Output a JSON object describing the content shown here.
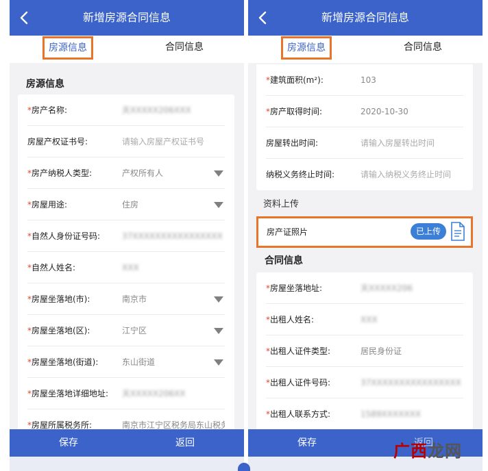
{
  "left": {
    "title": "新增房源合同信息",
    "tabs": {
      "source": "房源信息",
      "contract": "合同信息"
    },
    "section_title": "房源信息",
    "rows": [
      {
        "label": "房产名称:",
        "required": true,
        "value": "天XXXXX206XXX",
        "kind": "blur"
      },
      {
        "label": "房屋产权证书号:",
        "required": false,
        "value": "请输入房屋产权证书号",
        "kind": "ph"
      },
      {
        "label": "房产纳税人类型:",
        "required": true,
        "value": "产权所有人",
        "kind": "select"
      },
      {
        "label": "房屋用途:",
        "required": true,
        "value": "住房",
        "kind": "select"
      },
      {
        "label": "自然人身份证号码:",
        "required": true,
        "value": "37XXXXXXXXXXXXXXXX",
        "kind": "blur"
      },
      {
        "label": "自然人姓名:",
        "required": true,
        "value": "XXX",
        "kind": "blur"
      },
      {
        "label": "房屋坐落地(市):",
        "required": true,
        "value": "南京市",
        "kind": "select"
      },
      {
        "label": "房屋坐落地(区):",
        "required": true,
        "value": "江宁区",
        "kind": "select"
      },
      {
        "label": "房屋坐落地(街道):",
        "required": true,
        "value": "东山街道",
        "kind": "select"
      },
      {
        "label": "房屋坐落地详细地址:",
        "required": true,
        "value": "天XXXXX206XX",
        "kind": "blur"
      },
      {
        "label": "房屋所属税务所:",
        "required": true,
        "value": "南京市江宁区税务局东山税务",
        "kind": "text"
      }
    ],
    "buttons": {
      "save": "保存",
      "back": "返回"
    }
  },
  "right": {
    "title": "新增房源合同信息",
    "tabs": {
      "source": "房源信息",
      "contract": "合同信息"
    },
    "top_rows": [
      {
        "label": "建筑面积(m²):",
        "required": true,
        "value": "103",
        "kind": "text"
      },
      {
        "label": "房产取得时间:",
        "required": true,
        "value": "2020-10-30",
        "kind": "text"
      },
      {
        "label": "房屋转出时间:",
        "required": false,
        "value": "请输入房屋转出时间",
        "kind": "ph"
      },
      {
        "label": "纳税义务终止时间:",
        "required": false,
        "value": "请输入纳税义务终止时间",
        "kind": "ph"
      }
    ],
    "upload_section": "资料上传",
    "upload_label": "房产证照片",
    "upload_status": "已上传",
    "contract_title": "合同信息",
    "contract_rows": [
      {
        "label": "房屋坐落地址:",
        "required": true,
        "value": "天XXXXX206",
        "kind": "blur"
      },
      {
        "label": "出租人姓名:",
        "required": true,
        "value": "XXX",
        "kind": "blur"
      },
      {
        "label": "出租人证件类型:",
        "required": true,
        "value": "居民身份证",
        "kind": "text"
      },
      {
        "label": "出租人证件号码:",
        "required": true,
        "value": "37XXXXXXXXXXXXXXXX",
        "kind": "blur"
      },
      {
        "label": "出租人联系方式:",
        "required": true,
        "value": "1589XXXXXXX",
        "kind": "blur"
      }
    ],
    "buttons": {
      "save": "保存",
      "back": "返回"
    }
  },
  "watermark": {
    "brand": "广西龙网"
  },
  "colors": {
    "primary": "#3b63c9",
    "highlight": "#e8742a",
    "required": "#e0452f",
    "pill": "#3b7fd6"
  },
  "icons": {
    "back": "chevron-left-icon",
    "select": "caret-down-icon",
    "document": "document-icon"
  }
}
